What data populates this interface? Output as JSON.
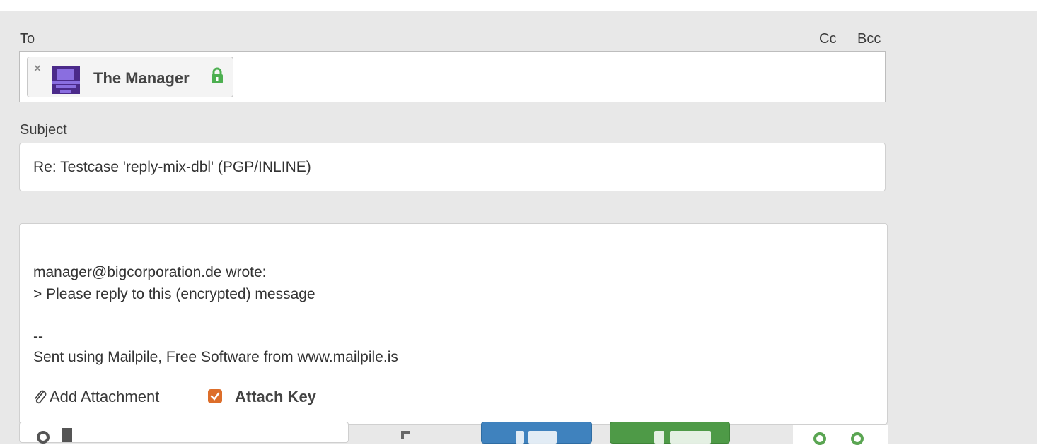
{
  "recipients": {
    "label": "To",
    "cc_label": "Cc",
    "bcc_label": "Bcc",
    "chips": [
      {
        "name": "The Manager",
        "remove_glyph": "×",
        "avatar_icon": "robot-avatar-icon",
        "lock_icon": "lock-icon"
      }
    ]
  },
  "subject": {
    "label": "Subject",
    "value": "Re: Testcase 'reply-mix-dbl' (PGP/INLINE)"
  },
  "body": {
    "lines": [
      "manager@bigcorporation.de wrote:",
      "> Please reply to this (encrypted) message",
      "--",
      "Sent using Mailpile, Free Software from www.mailpile.is"
    ]
  },
  "attachments": {
    "add_label": "Add Attachment",
    "add_icon": "paperclip-icon",
    "attach_key_label": "Attach Key",
    "attach_key_checked": true
  },
  "colors": {
    "background": "#e8e8e8",
    "checkbox": "#dd6e2a",
    "lock": "#4caf50",
    "save_button": "#3f82be",
    "send_button": "#4e9a47",
    "avatar": "#4b2a8a"
  }
}
